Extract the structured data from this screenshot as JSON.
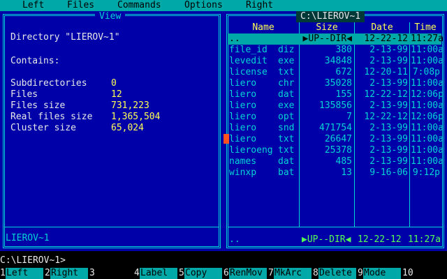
{
  "menu": {
    "items": [
      "Left",
      "Files",
      "Commands",
      "Options",
      "Right"
    ]
  },
  "left_panel": {
    "title": "View",
    "directory_line": "Directory \"LIEROV~1\"",
    "contains_label": "Contains:",
    "stats": [
      {
        "label": "Subdirectories",
        "value": "0"
      },
      {
        "label": "Files",
        "value": "12"
      },
      {
        "label": "Files size",
        "value": "731,223"
      },
      {
        "label": "Real files size",
        "value": "1,365,504"
      },
      {
        "label": "Cluster size",
        "value": "65,024"
      }
    ],
    "footer": "LIEROV~1"
  },
  "right_panel": {
    "path": "C:\\LIEROV~1",
    "columns": [
      "Name",
      "Size",
      "Date",
      "Time"
    ],
    "rows": [
      {
        "name": "..",
        "ext": "",
        "size": "▶UP--DIR◀",
        "date": "12-22-12",
        "time": "11:27a",
        "selected": true
      },
      {
        "name": "file_id",
        "ext": "diz",
        "size": "380",
        "date": "2-13-99",
        "time": "11:00a"
      },
      {
        "name": "levedit",
        "ext": "exe",
        "size": "34848",
        "date": "2-13-99",
        "time": "11:00a"
      },
      {
        "name": "license",
        "ext": "txt",
        "size": "672",
        "date": "12-20-11",
        "time": "7:08p"
      },
      {
        "name": "liero",
        "ext": "chr",
        "size": "35028",
        "date": "2-13-99",
        "time": "11:00a"
      },
      {
        "name": "liero",
        "ext": "dat",
        "size": "155",
        "date": "12-22-12",
        "time": "12:06p"
      },
      {
        "name": "liero",
        "ext": "exe",
        "size": "135856",
        "date": "2-13-99",
        "time": "11:00a"
      },
      {
        "name": "liero",
        "ext": "opt",
        "size": "7",
        "date": "12-22-12",
        "time": "12:06p"
      },
      {
        "name": "liero",
        "ext": "snd",
        "size": "471754",
        "date": "2-13-99",
        "time": "11:00a"
      },
      {
        "name": "liero",
        "ext": "txt",
        "size": "26647",
        "date": "2-13-99",
        "time": "11:00a"
      },
      {
        "name": "lieroeng",
        "ext": "txt",
        "size": "25378",
        "date": "2-13-99",
        "time": "11:00a"
      },
      {
        "name": "names",
        "ext": "dat",
        "size": "485",
        "date": "2-13-99",
        "time": "11:00a"
      },
      {
        "name": "winxp",
        "ext": "bat",
        "size": "13",
        "date": "9-16-06",
        "time": "9:12p"
      }
    ],
    "footer": {
      "name": "..",
      "size": "▶UP--DIR◀",
      "date": "12-22-12",
      "time": "11:27a"
    }
  },
  "command_line": "C:\\LIEROV~1>",
  "function_keys": [
    {
      "num": "1",
      "label": "Left"
    },
    {
      "num": "2",
      "label": "Right"
    },
    {
      "num": "3",
      "label": ""
    },
    {
      "num": "4",
      "label": "Label"
    },
    {
      "num": "5",
      "label": "Copy"
    },
    {
      "num": "6",
      "label": "RenMov"
    },
    {
      "num": "7",
      "label": "MkArc"
    },
    {
      "num": "8",
      "label": "Delete"
    },
    {
      "num": "9",
      "label": "Mode"
    },
    {
      "num": "10",
      "label": ""
    }
  ],
  "colors": {
    "panel_bg": "#0000a8",
    "border": "#00d4d4",
    "menu_bg": "#00a8a8",
    "value_yellow": "#ffff54",
    "footer_green": "#54ff54"
  }
}
